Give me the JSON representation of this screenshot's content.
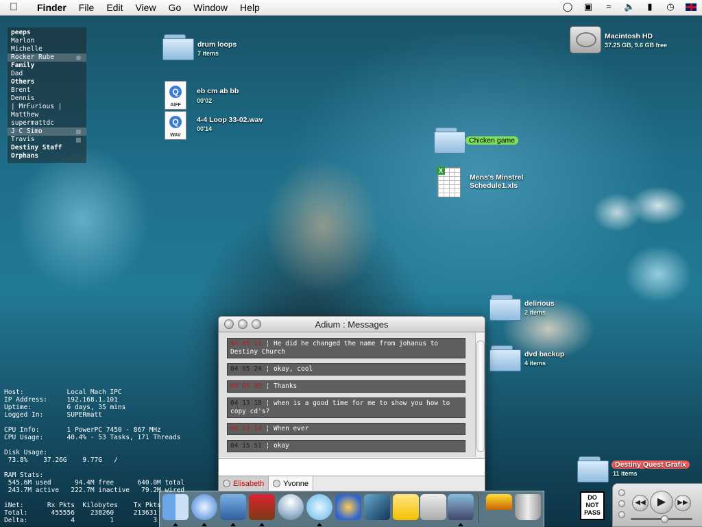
{
  "menubar": {
    "app": "Finder",
    "items": [
      "File",
      "Edit",
      "View",
      "Go",
      "Window",
      "Help"
    ]
  },
  "buddy_list": [
    {
      "label": "peeps",
      "group": true
    },
    {
      "label": "Marlon",
      "group": false
    },
    {
      "label": "Michelle",
      "group": false
    },
    {
      "label": "Rocker Rube",
      "group": false,
      "selected": true
    },
    {
      "label": "Family",
      "group": true
    },
    {
      "label": "Dad",
      "group": false
    },
    {
      "label": "Others",
      "group": true
    },
    {
      "label": "Brent",
      "group": false
    },
    {
      "label": "Dennis",
      "group": false
    },
    {
      "label": "| MrFurious |",
      "group": false
    },
    {
      "label": "Matthew",
      "group": false
    },
    {
      "label": "supermattdc",
      "group": false
    },
    {
      "label": "J C Simo",
      "group": false,
      "selected": true
    },
    {
      "label": "Travis",
      "group": false
    },
    {
      "label": "Destiny Staff",
      "group": true
    },
    {
      "label": "Orphans",
      "group": true
    }
  ],
  "desktop": {
    "drum_loops": {
      "name": "drum loops",
      "info": "7 items"
    },
    "aiff": {
      "name": "eb cm ab bb",
      "info": "00'02",
      "type": "AIFF"
    },
    "wav": {
      "name": "4-4 Loop 33-02.wav",
      "info": "00'14",
      "type": "WAV"
    },
    "hd": {
      "name": "Macintosh HD",
      "info": "37.25 GB, 9.6 GB free"
    },
    "chicken": {
      "name": "Chicken game"
    },
    "xls": {
      "name1": "Mens's Minstrel",
      "name2": "Schedule1.xls"
    },
    "delirious": {
      "name": "delirious",
      "info": "2 items"
    },
    "dvd": {
      "name": "dvd backup",
      "info": "4 items"
    },
    "destiny": {
      "name": "Destiny Quest Grafix",
      "info": "11 items"
    }
  },
  "stats": {
    "host": "Host:           Local Mach IPC",
    "ip": "IP Address:     192.168.1.101",
    "uptime": "Uptime:         6 days, 35 mins",
    "logged": "Logged In:      SUPERmatt",
    "cpu_info": "CPU Info:       1 PowerPC 7450 - 867 MHz",
    "cpu_usage": "CPU Usage:      40.4% - 53 Tasks, 171 Threads",
    "disk_h": "Disk Usage:",
    "disk": " 73.8%    37.26G    9.77G   /",
    "ram_h": "RAM Stats:",
    "ram1": " 545.6M used      94.4M free      640.0M total",
    "ram2": " 243.7M active   222.7M inactive   79.2M wired",
    "inet_h": "iNet:      Rx Pkts  Kilobytes    Tx Pkts",
    "total": "Total:      455556    238260     213631",
    "delta": "Delta:           4         1          3"
  },
  "adium": {
    "title": "Adium : Messages",
    "messages": [
      {
        "time": "04 05 11",
        "text": "He did he changed the name from johanus to Destiny Church",
        "red": true
      },
      {
        "time": "04 05 24",
        "text": "okay, cool",
        "red": false
      },
      {
        "time": "04 05 45",
        "text": "Thanks",
        "red": true
      },
      {
        "time": "04 13 18",
        "text": "when is a good time for me to show you how to copy cd's?",
        "red": false
      },
      {
        "time": "04 14 14",
        "text": "When ever",
        "red": true
      },
      {
        "time": "04 15 51",
        "text": "okay",
        "red": false
      }
    ],
    "tabs": [
      "Elisabeth",
      "Yvonne"
    ]
  },
  "dock": {
    "items": [
      "finder-icon",
      "safari-icon",
      "mail-icon",
      "mario-icon",
      "disk-icon",
      "itunes-icon",
      "iphoto-icon",
      "book-icon",
      "stickies-icon",
      "apple-icon",
      "photos-icon",
      "helicopter-icon",
      "trash-icon"
    ]
  },
  "do_not_pass": {
    "l1": "DO",
    "l2": "NOT",
    "l3": "PASS"
  }
}
